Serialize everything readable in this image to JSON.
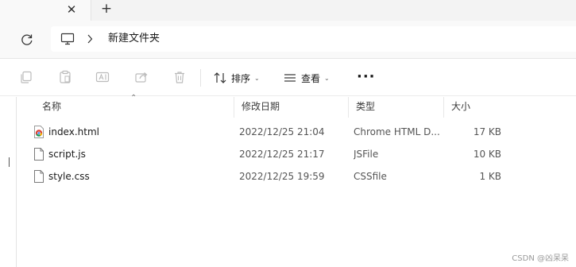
{
  "tabs": {
    "close_glyph": "✕",
    "new_tab_glyph": "+"
  },
  "address": {
    "breadcrumb": "新建文件夹"
  },
  "commandbar": {
    "sort_label": "排序",
    "view_label": "查看",
    "more_label": "···"
  },
  "columns": {
    "name": "名称",
    "date": "修改日期",
    "type": "类型",
    "size": "大小"
  },
  "files": [
    {
      "name": "index.html",
      "date": "2022/12/25 21:04",
      "type": "Chrome HTML D...",
      "size": "17 KB",
      "icon": "chrome-html-file-icon"
    },
    {
      "name": "script.js",
      "date": "2022/12/25 21:17",
      "type": "JSFile",
      "size": "10 KB",
      "icon": "file-icon"
    },
    {
      "name": "style.css",
      "date": "2022/12/25 19:59",
      "type": "CSSfile",
      "size": "1 KB",
      "icon": "file-icon"
    }
  ],
  "watermark": "CSDN @凶呆呆",
  "colors": {
    "tabstrip_bg": "#f3f3f3",
    "address_bg": "#f9f9f9",
    "disabled_icon": "#bcbcbc",
    "chrome_red": "#db4437",
    "chrome_green": "#0f9d58",
    "chrome_yellow": "#f4b400",
    "chrome_blue": "#4285f4"
  }
}
